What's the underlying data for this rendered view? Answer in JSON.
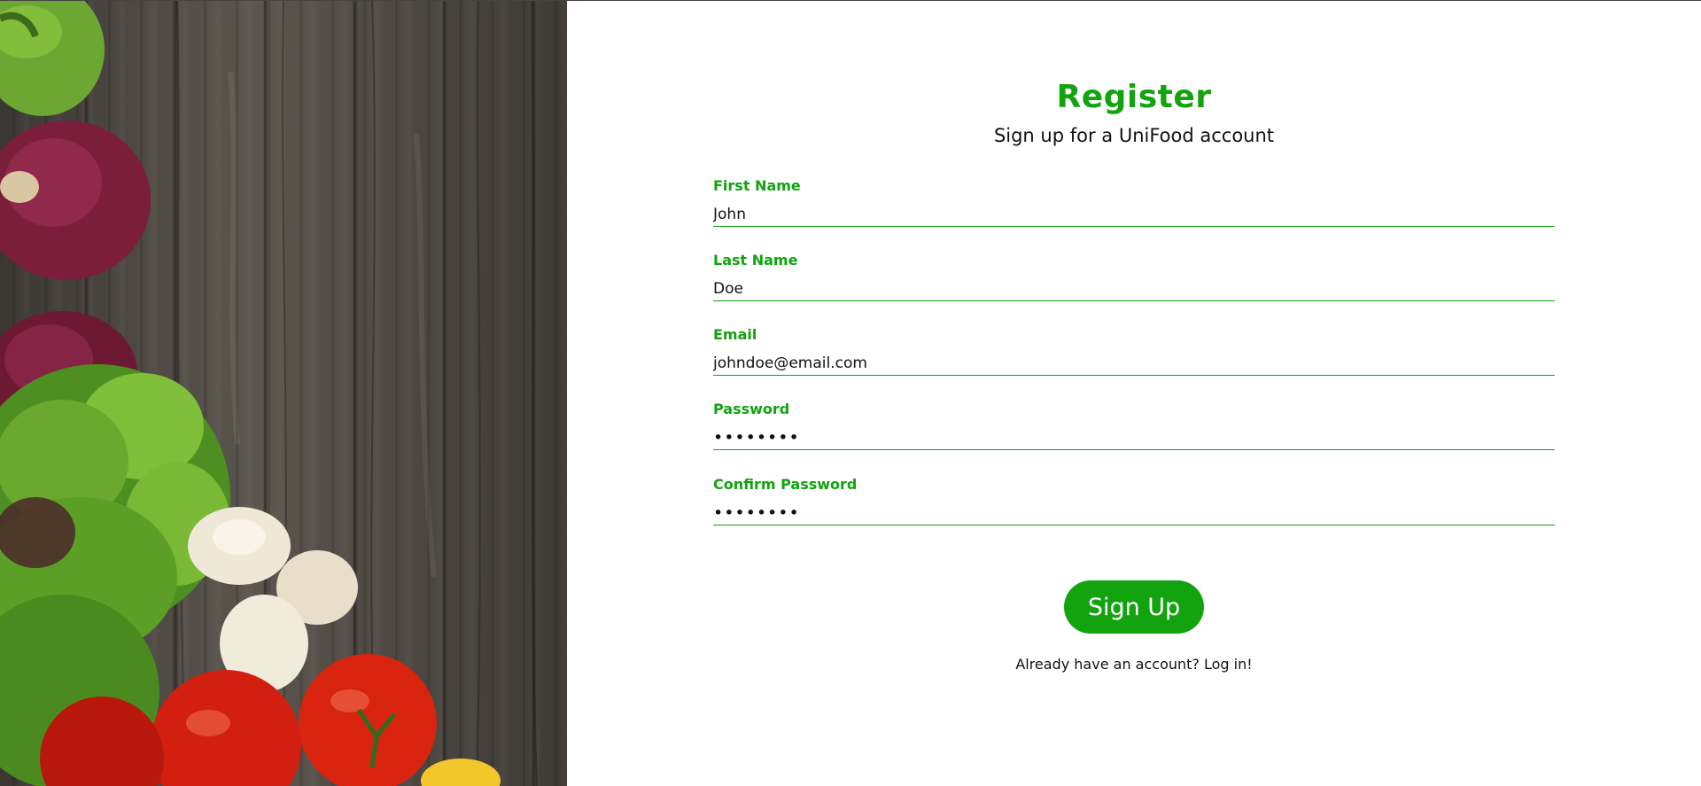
{
  "form": {
    "title": "Register",
    "subtitle": "Sign up for a UniFood account",
    "fields": [
      {
        "label": "First Name",
        "value": "John"
      },
      {
        "label": "Last Name",
        "value": "Doe"
      },
      {
        "label": "Email",
        "value": "johndoe@email.com"
      },
      {
        "label": "Password",
        "value": "password"
      },
      {
        "label": "Confirm Password",
        "value": "password"
      }
    ],
    "submit_label": "Sign Up",
    "login_prompt": "Already have an account?",
    "login_link": "Log in!"
  },
  "theme": {
    "accent": "#12a30f",
    "text": "#111111",
    "background": "#ffffff",
    "wood": "#4a4540"
  },
  "decor": {
    "image": "vegetables-on-wood-photo"
  }
}
